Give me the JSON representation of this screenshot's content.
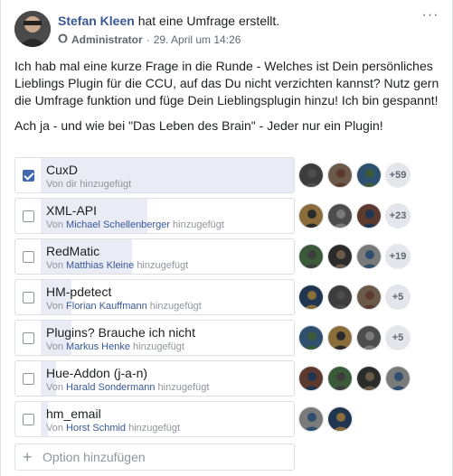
{
  "post": {
    "author": "Stefan Kleen",
    "action": "hat eine Umfrage erstellt.",
    "role": "Administrator",
    "date": "29. April um 14:26",
    "paragraph1": "Ich hab mal eine kurze Frage in die Runde - Welches ist Dein persönliches Lieblings Plugin für die CCU, auf das Du nicht verzichten kannst? Nutz gern die Umfrage funktion und füge Dein Lieblingsplugin hinzu! Ich bin gespannt!",
    "paragraph2": "Ach ja - und wie bei \"Das Leben des Brain\" - Jeder nur ein Plugin!",
    "more_icon": "ellipsis-icon",
    "separator": "·"
  },
  "poll": {
    "options": [
      {
        "label": "CuxD",
        "sub_prefix": "Von dir hinzugefügt",
        "by": "",
        "sub_suffix": "",
        "checked": true,
        "share": 1.0,
        "more": "+59",
        "voter_count": 3
      },
      {
        "label": "XML-API",
        "sub_prefix": "Von",
        "by": "Michael Schellenberger",
        "sub_suffix": "hinzugefügt",
        "checked": false,
        "share": 0.42,
        "more": "+23",
        "voter_count": 3
      },
      {
        "label": "RedMatic",
        "sub_prefix": "Von",
        "by": "Matthias Kleine",
        "sub_suffix": "hinzugefügt",
        "checked": false,
        "share": 0.36,
        "more": "+19",
        "voter_count": 3
      },
      {
        "label": "HM-pdetect",
        "sub_prefix": "Von",
        "by": "Florian Kauffmann",
        "sub_suffix": "hinzugefügt",
        "checked": false,
        "share": 0.12,
        "more": "+5",
        "voter_count": 3
      },
      {
        "label": "Plugins? Brauche ich nicht",
        "sub_prefix": "Von",
        "by": "Markus Henke",
        "sub_suffix": "hinzugefügt",
        "checked": false,
        "share": 0.12,
        "more": "+5",
        "voter_count": 3
      },
      {
        "label": "Hue-Addon (j-a-n)",
        "sub_prefix": "Von",
        "by": "Harald Sondermann",
        "sub_suffix": "hinzugefügt",
        "checked": false,
        "share": 0.06,
        "more": "",
        "voter_count": 4
      },
      {
        "label": "hm_email",
        "sub_prefix": "Von",
        "by": "Horst Schmid",
        "sub_suffix": "hinzugefügt",
        "checked": false,
        "share": 0.03,
        "more": "",
        "voter_count": 2
      }
    ],
    "add_option_placeholder": "Option hinzufügen",
    "add_icon": "plus-icon"
  },
  "colors": {
    "link": "#385898",
    "fill": "#e9ebf5",
    "checkbox_checked": "#4267b2"
  }
}
